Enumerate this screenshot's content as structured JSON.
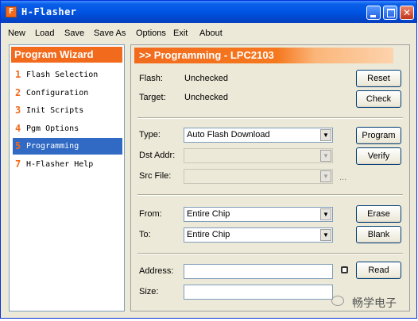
{
  "window": {
    "title": "H-Flasher",
    "app_icon": "F"
  },
  "menu": [
    "New",
    "Load",
    "Save",
    "Save As",
    "Options",
    "Exit",
    "About"
  ],
  "wizard": {
    "header": "Program Wizard",
    "items": [
      {
        "num": "1",
        "label": "Flash Selection"
      },
      {
        "num": "2",
        "label": "Configuration"
      },
      {
        "num": "3",
        "label": "Init Scripts"
      },
      {
        "num": "4",
        "label": "Pgm Options"
      },
      {
        "num": "5",
        "label": "Programming"
      },
      {
        "num": "7",
        "label": "H-Flasher Help"
      }
    ],
    "selected_index": 4
  },
  "panel": {
    "title": ">> Programming - LPC2103",
    "flash": {
      "label": "Flash:",
      "value": "Unchecked"
    },
    "target": {
      "label": "Target:",
      "value": "Unchecked"
    },
    "type": {
      "label": "Type:",
      "value": "Auto Flash Download"
    },
    "dst_addr": {
      "label": "Dst Addr:",
      "value": ""
    },
    "src_file": {
      "label": "Src File:",
      "value": "",
      "browse": "..."
    },
    "from": {
      "label": "From:",
      "value": "Entire Chip"
    },
    "to": {
      "label": "To:",
      "value": "Entire Chip"
    },
    "address": {
      "label": "Address:",
      "value": ""
    },
    "size": {
      "label": "Size:",
      "value": ""
    },
    "buttons": {
      "reset": "Reset",
      "check": "Check",
      "program": "Program",
      "verify": "Verify",
      "erase": "Erase",
      "blank": "Blank",
      "read": "Read"
    }
  },
  "watermark": "畅学电子",
  "colors": {
    "accent": "#f26b1d",
    "titlebar": "#0054e3",
    "selection": "#316ac5"
  }
}
